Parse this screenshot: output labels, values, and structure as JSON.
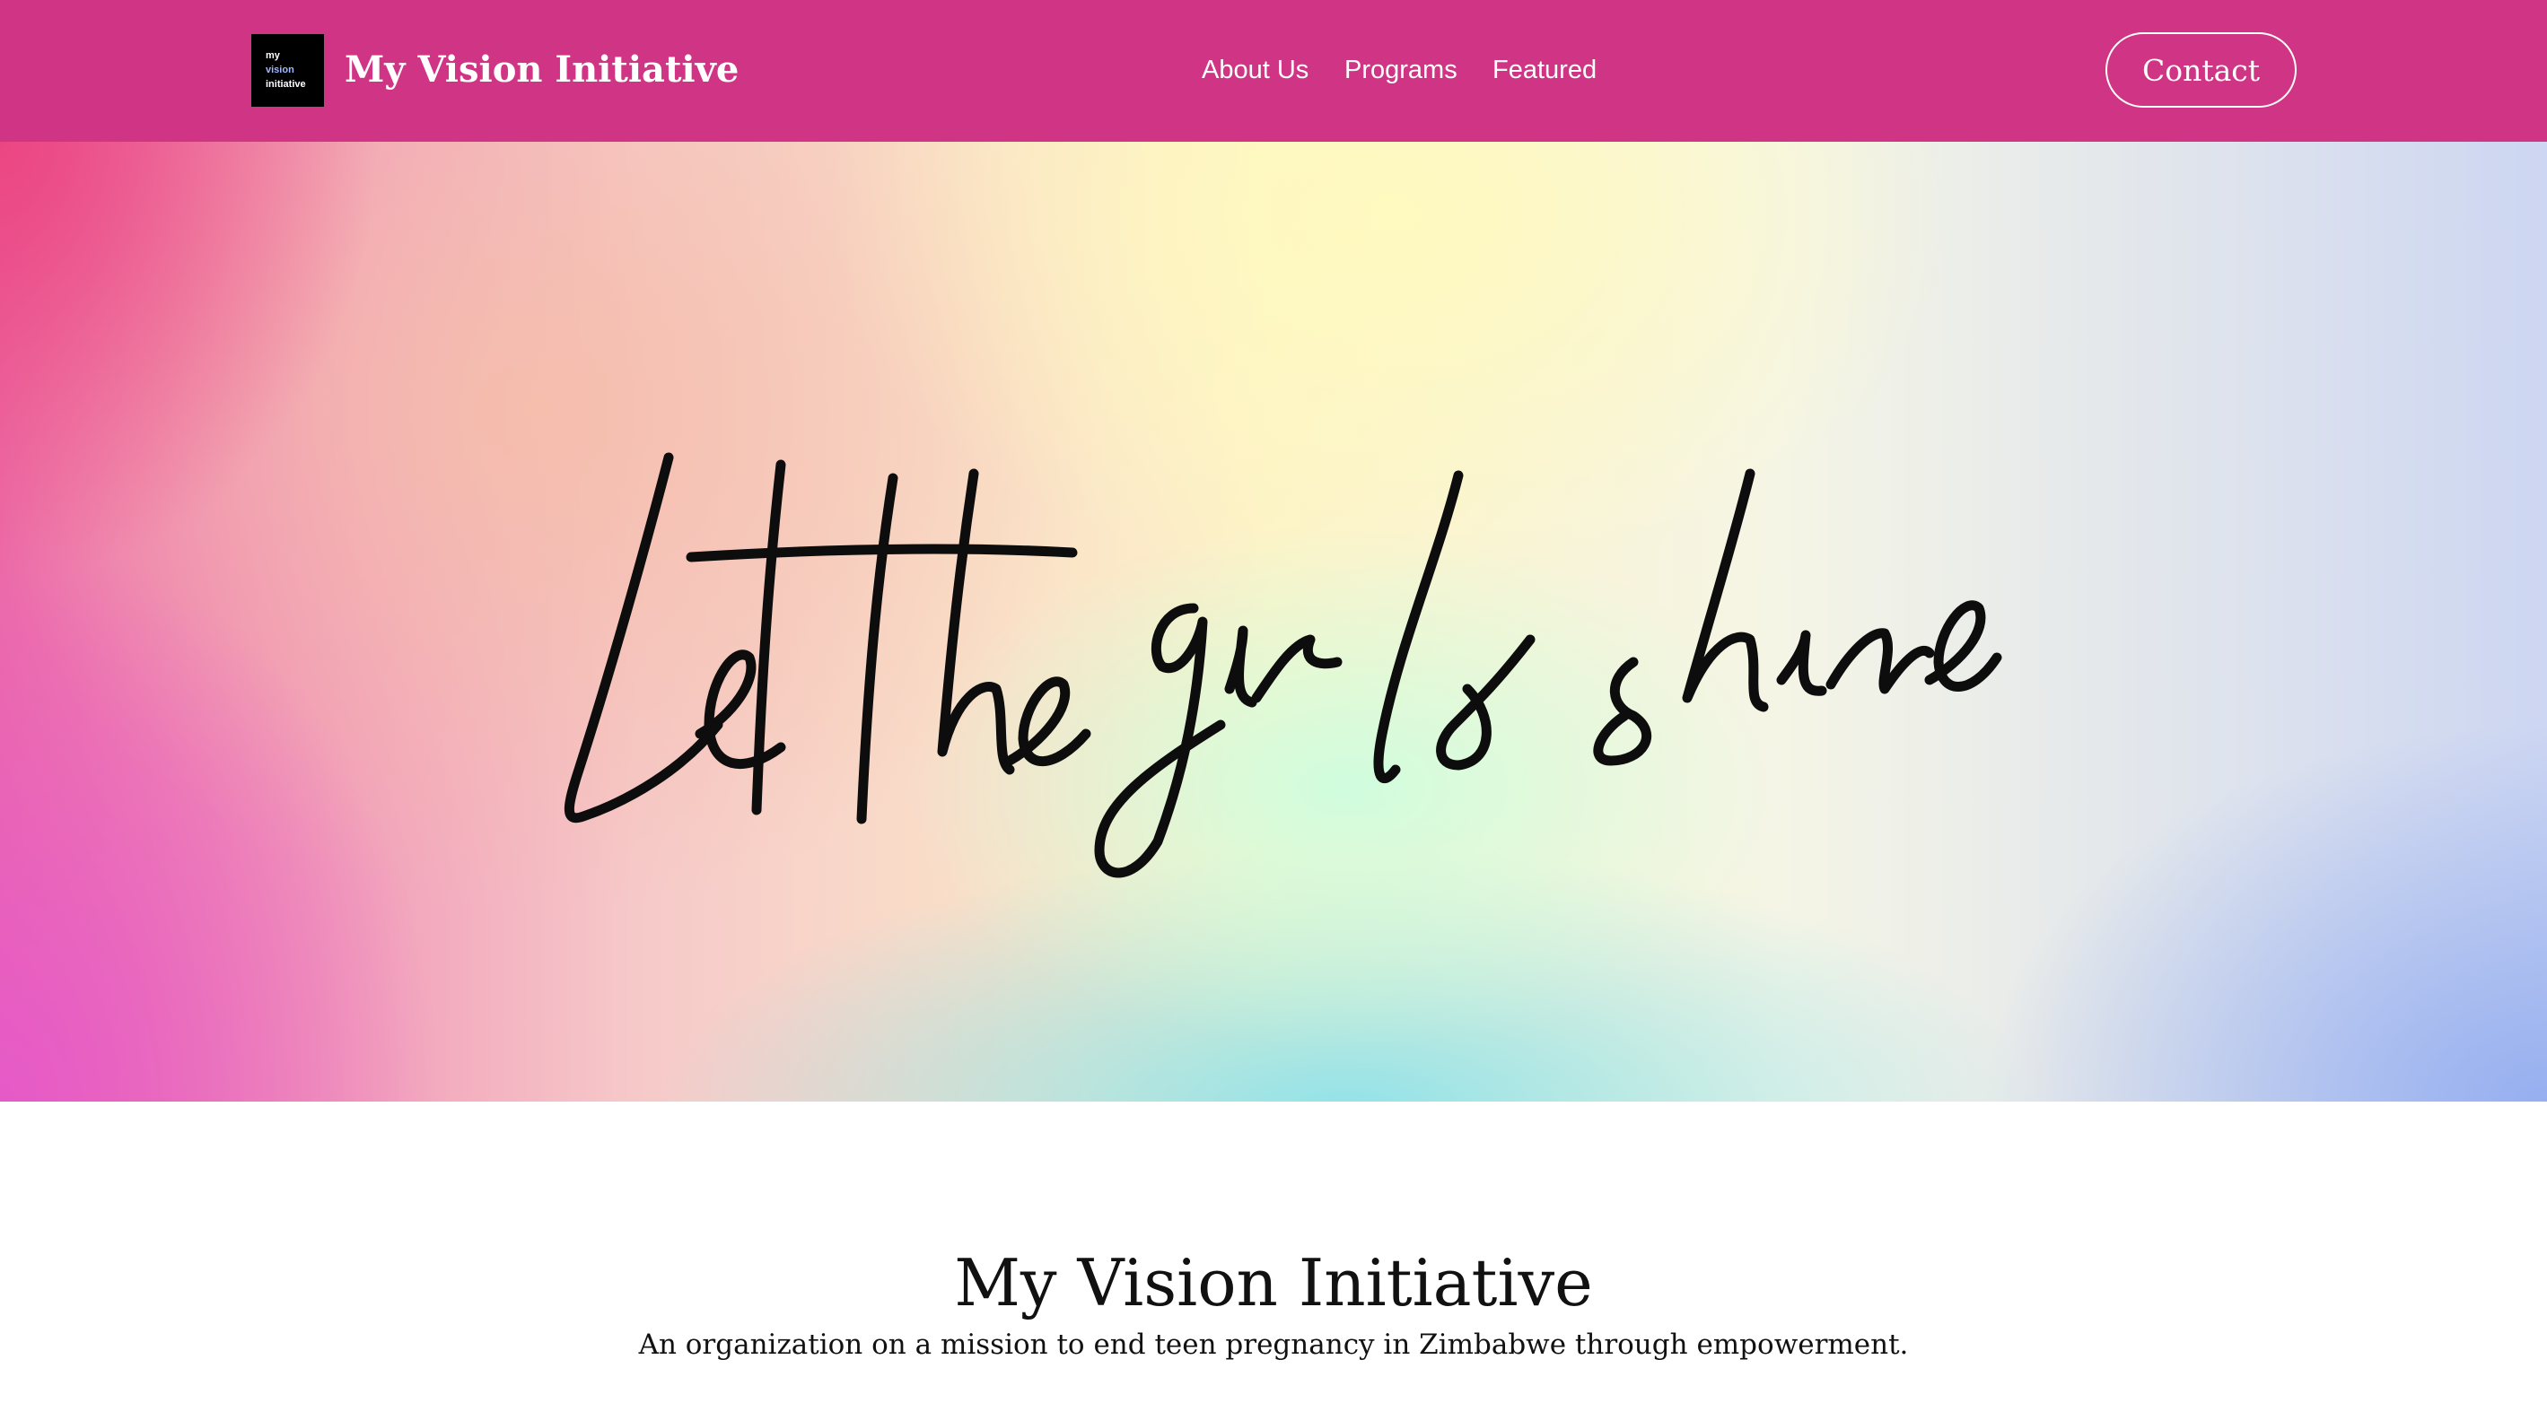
{
  "header": {
    "logo": {
      "line1": "my",
      "line2": "vision",
      "line3": "initiative"
    },
    "brand_name": "My Vision Initiative",
    "nav": {
      "about": "About Us",
      "programs": "Programs",
      "featured": "Featured"
    },
    "contact_label": "Contact"
  },
  "hero": {
    "script_text": "Let the girls shine"
  },
  "intro": {
    "title": "My Vision Initiative",
    "subtitle": "An organization on a mission to end teen pregnancy in Zimbabwe through empowerment."
  },
  "colors": {
    "header_bg": "#cf3584",
    "text_dark": "#111111",
    "text_light": "#ffffff"
  }
}
